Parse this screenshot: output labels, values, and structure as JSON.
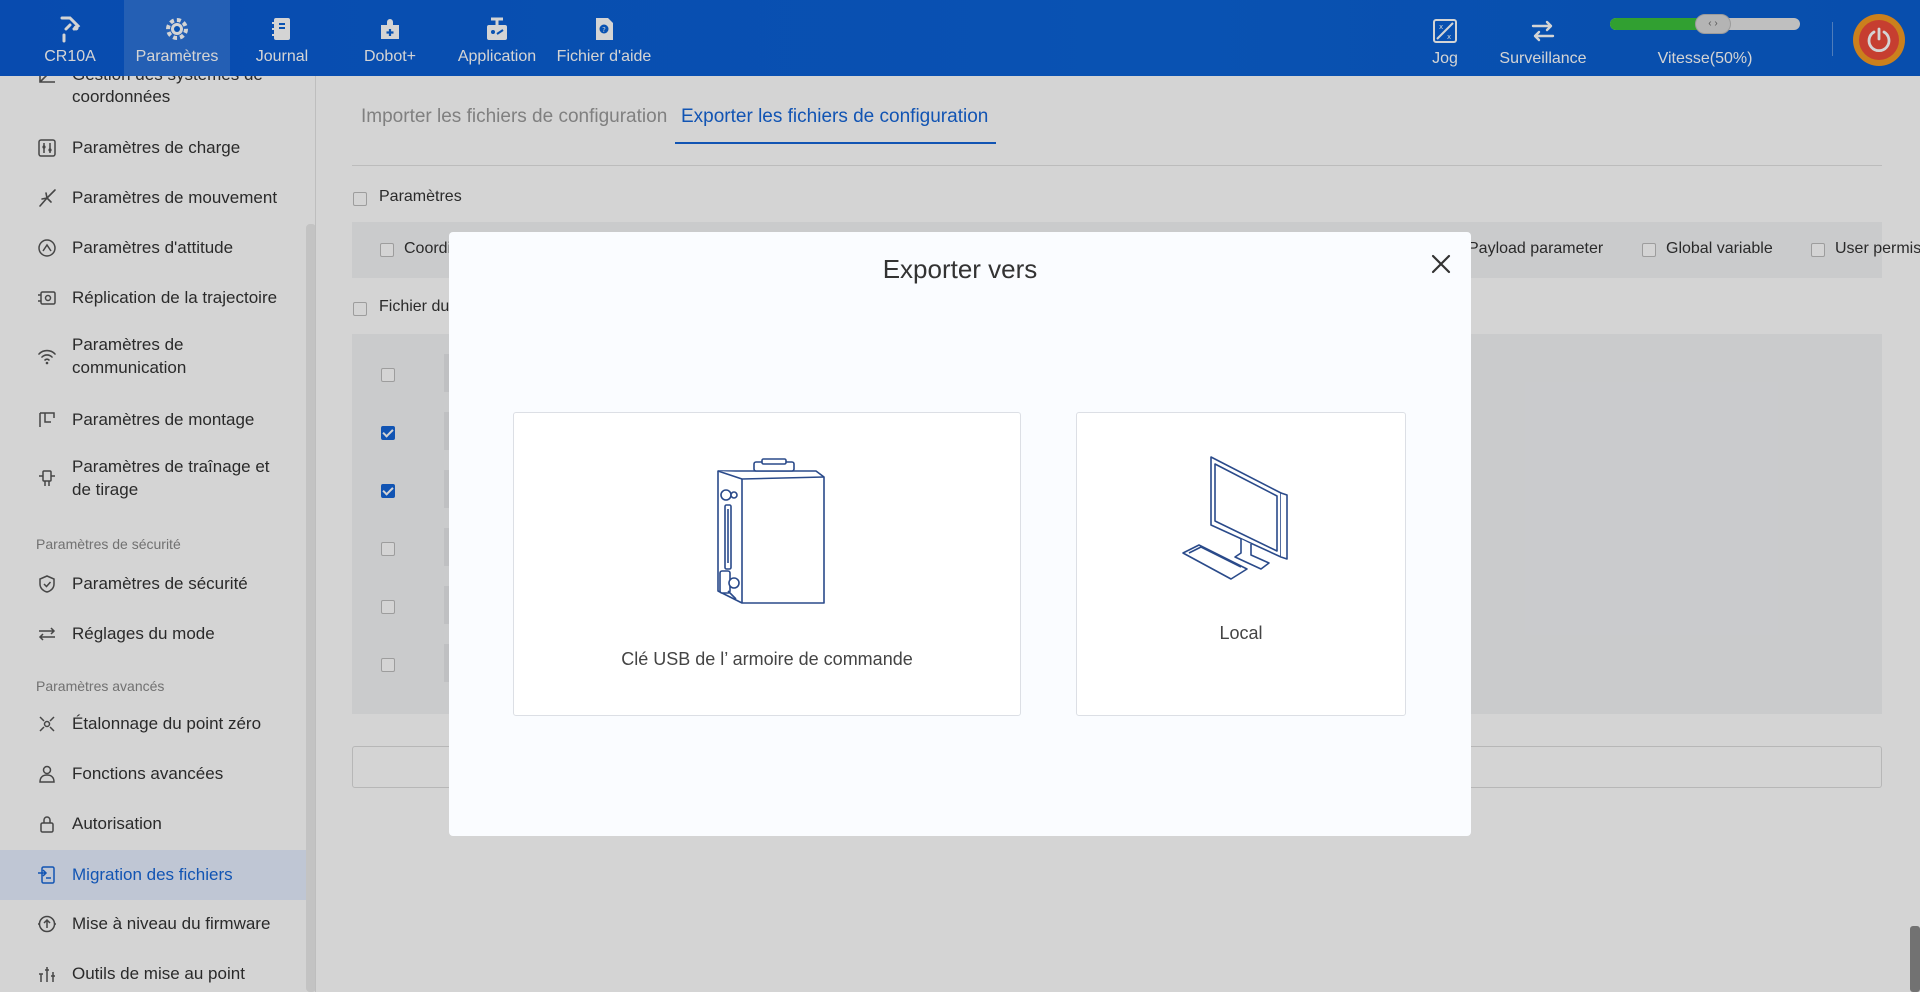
{
  "topbar": {
    "robot_name": "CR10A",
    "nav": [
      {
        "label": "CR10A",
        "icon": "robot-arm-icon"
      },
      {
        "label": "Paramètres",
        "icon": "gear-icon"
      },
      {
        "label": "Journal",
        "icon": "notebook-icon"
      },
      {
        "label": "Dobot+",
        "icon": "plugin-icon"
      },
      {
        "label": "Application",
        "icon": "application-icon"
      },
      {
        "label": "Fichier d'aide",
        "icon": "help-file-icon"
      }
    ],
    "jog_label": "Jog",
    "surveillance_label": "Surveillance",
    "speed_label": "Vitesse(50%)",
    "speed_percent": 50,
    "accent_color": "#0b63d6"
  },
  "sidebar": {
    "items_top": [
      {
        "label": "Gestion des systèmes de coordonnées",
        "icon": "coordinate-icon"
      },
      {
        "label": "Paramètres de charge",
        "icon": "load-sliders-icon"
      },
      {
        "label": "Paramètres de mouvement",
        "icon": "motion-icon"
      },
      {
        "label": "Paramètres d'attitude",
        "icon": "attitude-icon"
      },
      {
        "label": "Réplication de la trajectoire",
        "icon": "trajectory-icon"
      },
      {
        "label": "Paramètres de communication",
        "icon": "wifi-icon"
      },
      {
        "label": "Paramètres de montage",
        "icon": "mounting-icon"
      },
      {
        "label": "Paramètres de traînage et de tirage",
        "icon": "drag-icon"
      }
    ],
    "section_security": "Paramètres de sécurité",
    "items_security": [
      {
        "label": "Paramètres de sécurité",
        "icon": "shield-icon"
      },
      {
        "label": "Réglages du mode",
        "icon": "mode-arrows-icon"
      }
    ],
    "section_advanced": "Paramètres avancés",
    "items_advanced": [
      {
        "label": "Étalonnage du point zéro",
        "icon": "calibration-icon"
      },
      {
        "label": "Fonctions avancées",
        "icon": "user-icon"
      },
      {
        "label": "Autorisation",
        "icon": "lock-icon"
      },
      {
        "label": "Migration des fichiers",
        "icon": "file-migration-icon"
      },
      {
        "label": "Mise à niveau du firmware",
        "icon": "firmware-icon"
      },
      {
        "label": "Outils de mise au point",
        "icon": "tools-icon"
      }
    ],
    "active_item": "Migration des fichiers"
  },
  "main": {
    "tabs": [
      {
        "label": "Importer les fichiers de configuration",
        "active": false
      },
      {
        "label": "Exporter les fichiers de configuration",
        "active": true
      }
    ],
    "params_label": "Paramètres",
    "param_options": [
      {
        "label": "Coordinate",
        "checked": false
      },
      {
        "label": "Payload parameter",
        "checked": false
      },
      {
        "label": "Global variable",
        "checked": false
      },
      {
        "label": "User permis",
        "checked": false
      }
    ],
    "files_label": "Fichier du",
    "file_rows": [
      {
        "checked": false
      },
      {
        "checked": true
      },
      {
        "checked": true
      },
      {
        "checked": false
      },
      {
        "checked": false
      },
      {
        "checked": false
      }
    ],
    "code_icon_glyph": "</>"
  },
  "modal": {
    "title": "Exporter vers",
    "options": [
      {
        "label": "Clé USB de l’ armoire de commande",
        "icon": "controller-cabinet-icon"
      },
      {
        "label": "Local",
        "icon": "desktop-computer-icon"
      }
    ]
  }
}
